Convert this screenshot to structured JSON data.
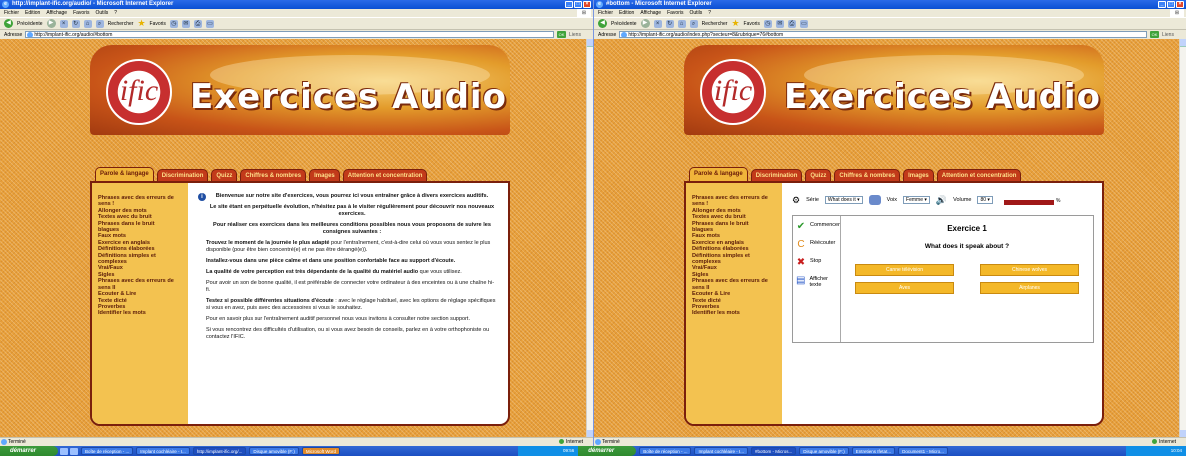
{
  "left": {
    "title": "http://implant-ific.org/audio/ - Microsoft Internet Explorer",
    "menu": [
      "Fichier",
      "Edition",
      "Affichage",
      "Favoris",
      "Outils",
      "?"
    ],
    "toolbar": {
      "back": "Précédente",
      "search": "Rechercher",
      "favorites": "Favoris"
    },
    "address_label": "Adresse",
    "address": "http://implant-ific.org/audio/#bottom",
    "go": "OK",
    "links": "Liens",
    "status": "Terminé",
    "zone": "Internet",
    "sidebar": [
      "Phrases avec des erreurs de sens !",
      "Allonger des mots",
      "Textes avec du bruit",
      "Phrases dans le bruit",
      "blagues",
      "Faux mots",
      "Exercice en anglais",
      "Définitions élaborées",
      "Définitions simples et complexes",
      "Vrai/Faux",
      "Sigles",
      "Phrases avec des erreurs de sens II",
      "Ecouter & Lire",
      "Texte dicté",
      "Proverbes",
      "Identifier les mots"
    ],
    "content": {
      "welcome": "Bienvenue sur notre site d'exercices, vous pourrez ici vous entraîner grâce à divers exercices auditifs.",
      "evolution": "Le site étant en perpétuelle évolution, n'hésitez pas à le visiter régulièrement pour découvrir nos nouveaux exercices.",
      "conditions": "Pour réaliser ces exercices dans les meilleures conditions possibles nous vous proposons de suivre les consignes suivantes :",
      "p1_bold": "Trouvez le moment de la journée le plus adapté",
      "p1_rest": " pour l'entraînement, c'est-à-dire celui où vous vous sentez le plus disponible (pour être bien concentré(e) et ne pas être dérangé(e)).",
      "p2_bold": "Installez-vous dans une pièce calme et dans une position confortable face au support d'écoute.",
      "p3_bold": "La qualité de votre perception est très dépendante de la qualité du matériel audio",
      "p3_rest": " que vous utilisez.",
      "p4": "Pour avoir un son de bonne qualité, il est préférable de connecter votre ordinateur à des enceintes ou à une chaîne hi-fi.",
      "p5_bold": "Testez si possible différentes situations d'écoute",
      "p5_rest": " : avec le réglage habituel, avec les options de réglage spécifiques si vous en avez, puis avec des accessoires si vous le souhaitez.",
      "p6": "Pour en savoir plus sur l'entraînement auditif personnel nous vous invitons à consulter notre section support.",
      "p7": "Si vous rencontrez des difficultés d'utilisation, ou si vous avez besoin de conseils, parlez en à votre orthophoniste ou contactez l'IFIC."
    }
  },
  "right": {
    "title": "#bottom - Microsoft Internet Explorer",
    "menu": [
      "Fichier",
      "Edition",
      "Affichage",
      "Favoris",
      "Outils",
      "?"
    ],
    "toolbar": {
      "back": "Précédente",
      "search": "Rechercher",
      "favorites": "Favoris"
    },
    "address_label": "Adresse",
    "address": "http://implant-ific.org/audio/index.php?secteur=8&rubrique=76#bottom",
    "go": "OK",
    "links": "Liens",
    "status": "Terminé",
    "zone": "Internet",
    "sidebar": [
      "Phrases avec des erreurs de sens !",
      "Allonger des mots",
      "Textes avec du bruit",
      "Phrases dans le bruit",
      "blagues",
      "Faux mots",
      "Exercice en anglais",
      "Définitions élaborées",
      "Définitions simples et complexes",
      "Vrai/Faux",
      "Sigles",
      "Phrases avec des erreurs de sens II",
      "Ecouter & Lire",
      "Texte dicté",
      "Proverbes",
      "Identifier les mots"
    ],
    "controls": {
      "serie_label": "Série",
      "serie_value": "What does it",
      "voix_label": "Voix",
      "voix_value": "Femme",
      "volume_label": "Volume",
      "volume_value": "80",
      "volume_pct": "%"
    },
    "actions": {
      "start": "Commencer",
      "replay": "Réécouter",
      "stop": "Stop",
      "show_text": "Afficher texte"
    },
    "exercise": {
      "title": "Exercice 1",
      "question": "What does it speak about ?",
      "answers": [
        "Canne télévision",
        "Chinese wolves",
        "Aves",
        "Airplanes"
      ]
    }
  },
  "site": {
    "logo": "ific",
    "banner": "Exercices Audio",
    "tabs": [
      "Parole & langage",
      "Discrimination",
      "Quizz",
      "Chiffres & nombres",
      "Images",
      "Attention et concentration"
    ]
  },
  "taskbar": {
    "start": "démarrer",
    "items": [
      "Boîte de réception - ...",
      "Implant cochléaire - I...",
      "http://implant-ific.org/...",
      "Disque amovible (F:)",
      "Microsoft Word",
      "Boîte de réception - ...",
      "Implant cochléaire - I...",
      "#bottom - Micros...",
      "Disque amovible (F:)",
      "Entretiens Ifetat...",
      "Document1 - Micro..."
    ],
    "clock_left": "09:56",
    "clock_right": "10:04"
  },
  "colors": {
    "accent": "#c23a1a",
    "tab_active": "#f0b43a",
    "sidebar": "#f3c250",
    "page_bg": "#e8a03a"
  }
}
